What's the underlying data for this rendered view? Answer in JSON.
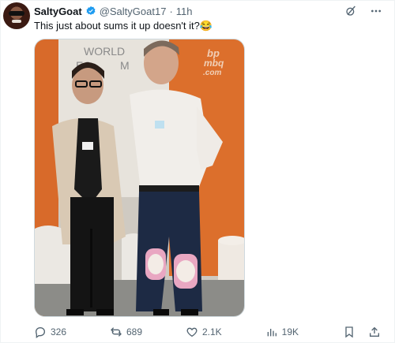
{
  "tweet": {
    "display_name": "SaltyGoat",
    "handle": "@SaltyGoat17",
    "separator": "·",
    "time": "11h",
    "text": "This just about sums it up doesn't it?😂"
  },
  "media": {
    "wall_text_1": "WORLD",
    "wall_text_2": "EC",
    "wall_text_3": "M",
    "watermark_1": "bp",
    "watermark_2": "mbq",
    "watermark_3": ".com"
  },
  "actions": {
    "replies": "326",
    "reposts": "689",
    "likes": "2.1K",
    "views": "19K"
  },
  "colors": {
    "verified_blue": "#1d9bf0",
    "secondary_text": "#536471",
    "orange_wall": "#e0762f",
    "knee_pad_pink": "#e9a7c2"
  }
}
